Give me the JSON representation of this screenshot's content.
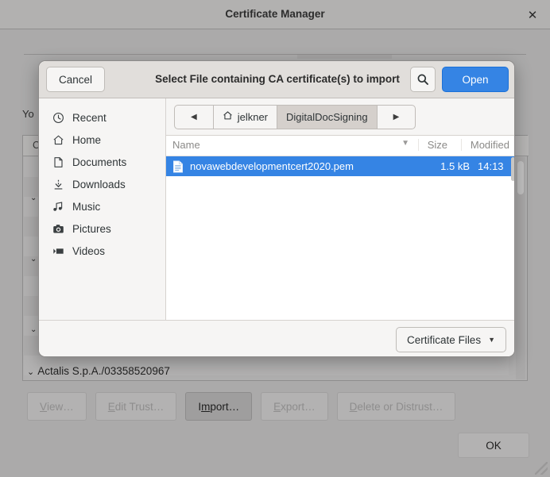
{
  "cert_manager": {
    "title": "Certificate Manager",
    "close_icon": "close-icon",
    "intro_text": "Yo",
    "list_header": "C",
    "columns_icon": "column-options-icon",
    "group_rows": [
      {
        "chevron": "⌄",
        "label": ""
      },
      {
        "chevron": "⌄",
        "label": ""
      },
      {
        "chevron": "⌄",
        "label": ""
      }
    ],
    "actalis_row": {
      "chevron": "⌄",
      "label": "Actalis S.p.A./03358520967"
    },
    "buttons": [
      {
        "label": "View…",
        "mnemonic": "V",
        "rest": "iew…",
        "enabled": false
      },
      {
        "label": "Edit Trust…",
        "mnemonic": "E",
        "rest": "dit Trust…",
        "enabled": false
      },
      {
        "label": "Import…",
        "mnemonic": "m",
        "pre": "I",
        "rest": "port…",
        "enabled": true
      },
      {
        "label": "Export…",
        "mnemonic": "E",
        "rest": "xport…",
        "enabled": false
      },
      {
        "label": "Delete or Distrust…",
        "mnemonic": "D",
        "rest": "elete or Distrust…",
        "enabled": false
      }
    ],
    "ok_label": "OK"
  },
  "file_dialog": {
    "cancel_label": "Cancel",
    "title": "Select File containing CA certificate(s) to import",
    "search_icon": "search-icon",
    "open_label": "Open",
    "sidebar": {
      "items": [
        {
          "label": "Recent",
          "icon": "clock-icon"
        },
        {
          "label": "Home",
          "icon": "home-icon"
        },
        {
          "label": "Documents",
          "icon": "document-icon"
        },
        {
          "label": "Downloads",
          "icon": "download-icon"
        },
        {
          "label": "Music",
          "icon": "music-note-icon"
        },
        {
          "label": "Pictures",
          "icon": "camera-icon"
        },
        {
          "label": "Videos",
          "icon": "video-icon"
        }
      ]
    },
    "pathbar": {
      "back_icon": "chevron-left-icon",
      "forward_icon": "chevron-right-icon",
      "crumbs": [
        {
          "label": "jelkner",
          "icon": "home-icon",
          "current": false
        },
        {
          "label": "DigitalDocSigning",
          "icon": "",
          "current": true
        }
      ]
    },
    "columns": {
      "name": "Name",
      "size": "Size",
      "modified": "Modified",
      "sort_icon": "sort-descending-icon"
    },
    "files": [
      {
        "icon": "text-file-icon",
        "name": "novawebdevelopmentcert2020.pem",
        "size": "1.5 kB",
        "modified": "14:13",
        "selected": true
      }
    ],
    "filter": {
      "label": "Certificate Files",
      "caret_icon": "chevron-down-icon"
    }
  },
  "colors": {
    "accent_blue": "#3584e4",
    "dialog_bg": "#f6f5f4",
    "window_bg": "#abaaaa",
    "header_bg": "#e1dedb"
  }
}
